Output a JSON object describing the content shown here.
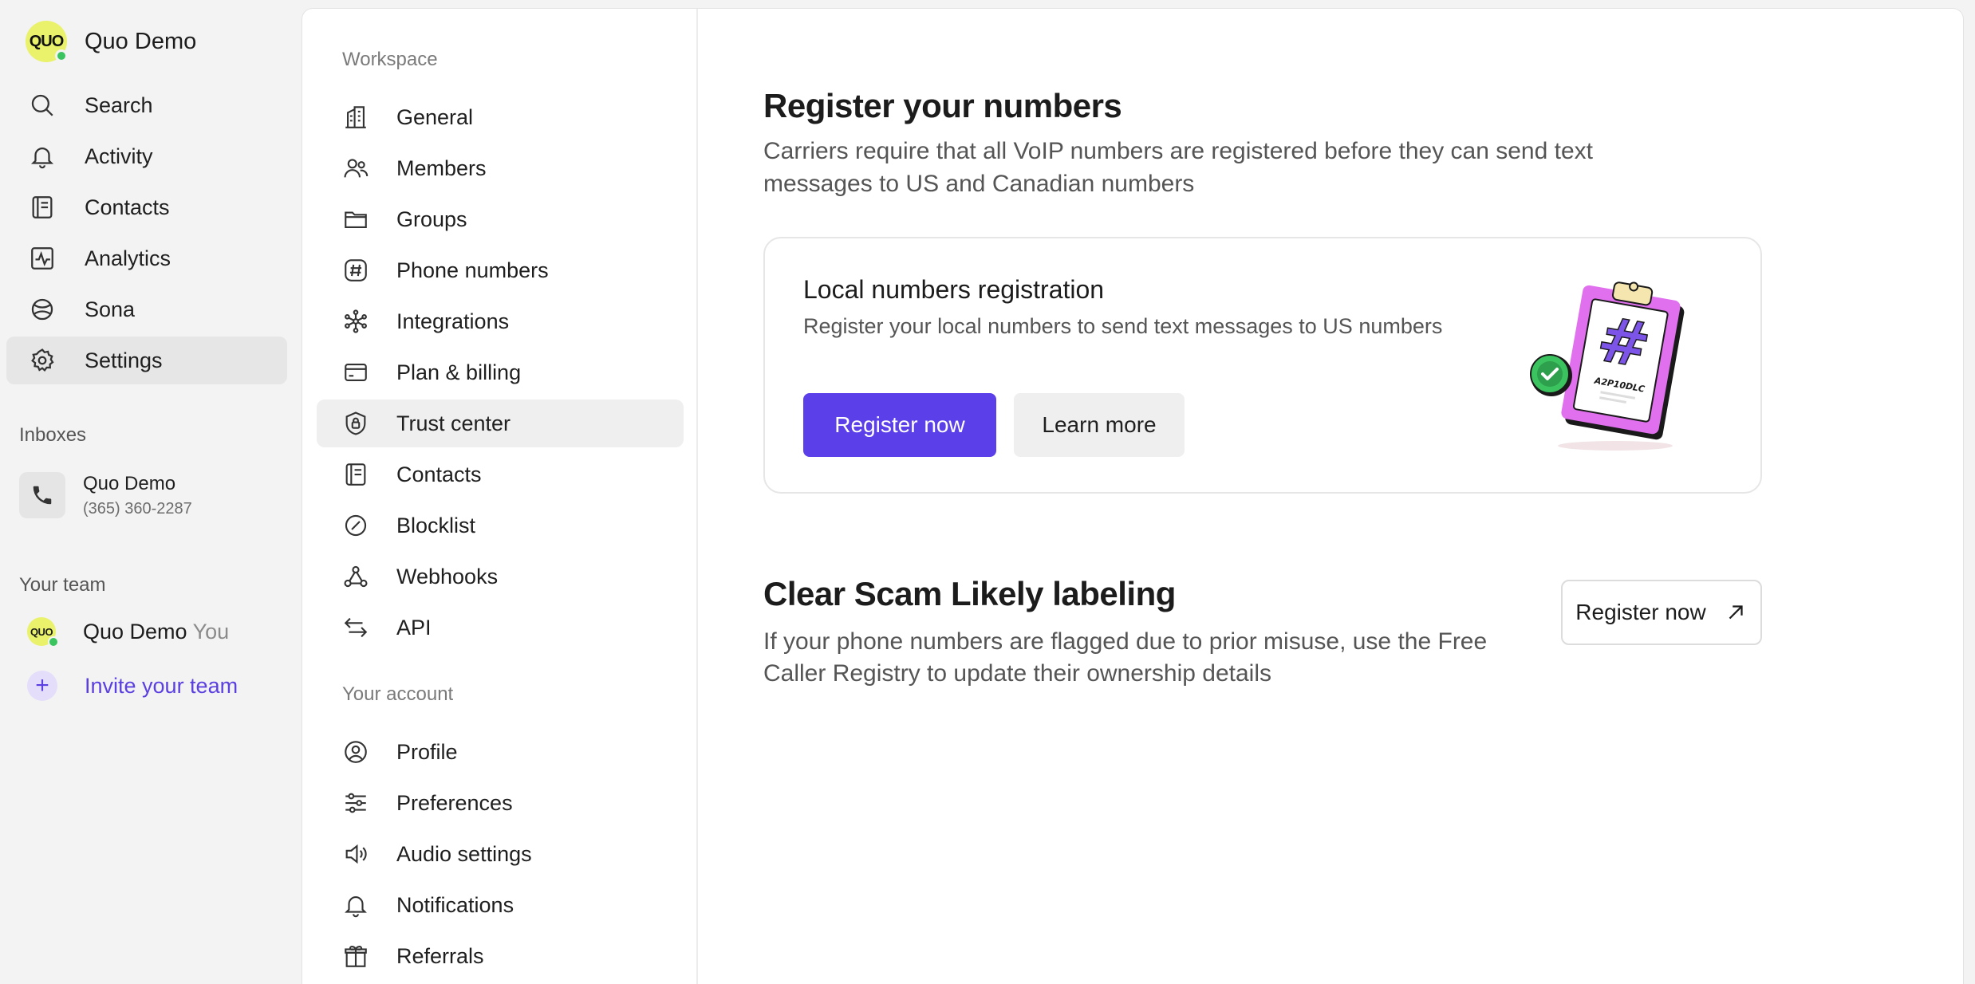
{
  "workspace": {
    "name": "Quo Demo",
    "logo_text": "QUO"
  },
  "nav": {
    "items": [
      {
        "label": "Search",
        "icon": "search-icon"
      },
      {
        "label": "Activity",
        "icon": "bell-icon"
      },
      {
        "label": "Contacts",
        "icon": "contacts-icon"
      },
      {
        "label": "Analytics",
        "icon": "analytics-icon"
      },
      {
        "label": "Sona",
        "icon": "sona-icon"
      },
      {
        "label": "Settings",
        "icon": "gear-icon",
        "active": true
      }
    ]
  },
  "inboxes": {
    "label": "Inboxes",
    "items": [
      {
        "name": "Quo Demo",
        "number": "(365) 360-2287"
      }
    ]
  },
  "team": {
    "label": "Your team",
    "member": {
      "name": "Quo Demo",
      "suffix": "You",
      "avatar_text": "QUO"
    },
    "invite_label": "Invite your team"
  },
  "settings_nav": {
    "workspace_label": "Workspace",
    "workspace_items": [
      {
        "label": "General",
        "icon": "building-icon"
      },
      {
        "label": "Members",
        "icon": "members-icon"
      },
      {
        "label": "Groups",
        "icon": "folder-icon"
      },
      {
        "label": "Phone numbers",
        "icon": "hash-icon"
      },
      {
        "label": "Integrations",
        "icon": "integrations-icon"
      },
      {
        "label": "Plan & billing",
        "icon": "card-icon"
      },
      {
        "label": "Trust center",
        "icon": "shield-lock-icon",
        "active": true
      },
      {
        "label": "Contacts",
        "icon": "contacts-icon"
      },
      {
        "label": "Blocklist",
        "icon": "block-icon"
      },
      {
        "label": "Webhooks",
        "icon": "webhooks-icon"
      },
      {
        "label": "API",
        "icon": "api-arrows-icon"
      }
    ],
    "account_label": "Your account",
    "account_items": [
      {
        "label": "Profile",
        "icon": "profile-icon"
      },
      {
        "label": "Preferences",
        "icon": "sliders-icon"
      },
      {
        "label": "Audio settings",
        "icon": "speaker-icon"
      },
      {
        "label": "Notifications",
        "icon": "bell-icon"
      },
      {
        "label": "Referrals",
        "icon": "gift-icon"
      }
    ]
  },
  "main": {
    "title": "Register your numbers",
    "subtitle": "Carriers require that all VoIP numbers are registered before they can send text messages to US and Canadian numbers",
    "card": {
      "title": "Local numbers registration",
      "description": "Register your local numbers to send text messages to US numbers",
      "primary_button": "Register now",
      "secondary_button": "Learn more",
      "illustration_text": "A2P10DLC"
    },
    "scam": {
      "title": "Clear Scam Likely labeling",
      "description": "If your phone numbers are flagged due to prior misuse, use the Free Caller Registry to update their ownership details",
      "button": "Register now"
    }
  },
  "colors": {
    "accent": "#5b3fe8",
    "logo": "#e9f26a",
    "online": "#3bc35f",
    "illustration": "#e070ee"
  }
}
